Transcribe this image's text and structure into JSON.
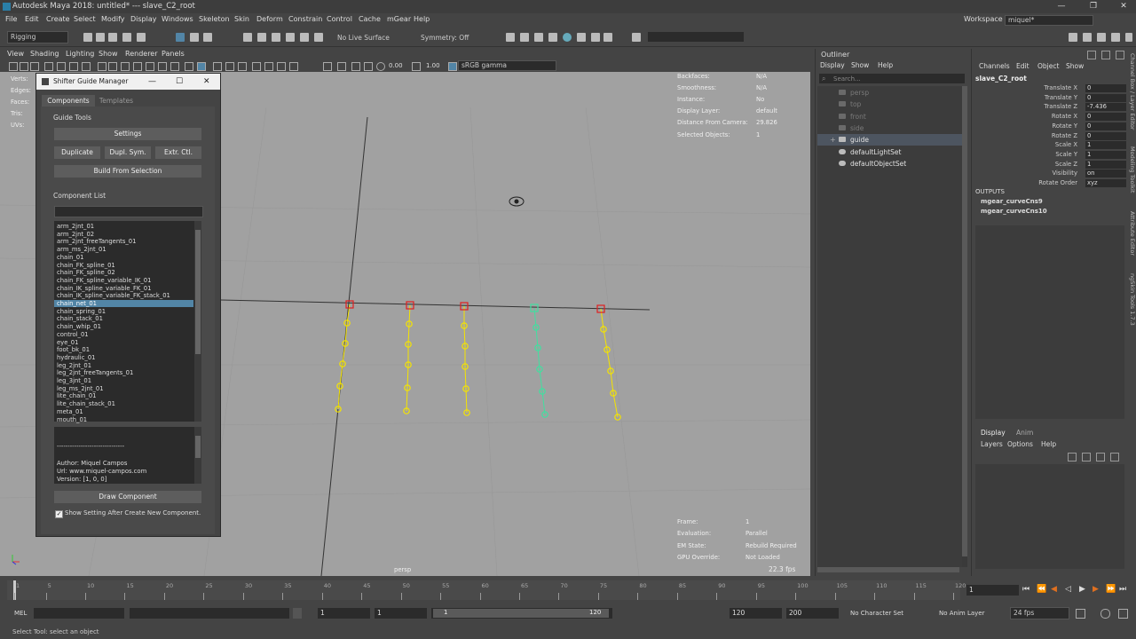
{
  "window": {
    "title": "Autodesk Maya 2018: untitled*   ---   slave_C2_root"
  },
  "menubar": [
    "File",
    "Edit",
    "Create",
    "Select",
    "Modify",
    "Display",
    "Windows",
    "Skeleton",
    "Skin",
    "Deform",
    "Constrain",
    "Control",
    "Cache",
    "mGear",
    "Help"
  ],
  "workspace": {
    "label": "Workspace :",
    "value": "miquel*"
  },
  "status": {
    "mode": "Rigging",
    "live_surface": "No Live Surface",
    "symmetry": "Symmetry: Off"
  },
  "viewport_menu": [
    "View",
    "Shading",
    "Lighting",
    "Show",
    "Renderer",
    "Panels"
  ],
  "viewport_toolbar": {
    "near": "0.00",
    "far": "1.00",
    "color_space": "sRGB gamma"
  },
  "hud_left": [
    "Verts:",
    "Edges:",
    "Faces:",
    "Tris:",
    "UVs:"
  ],
  "hud_top": [
    {
      "label": "Backfaces:",
      "value": "N/A"
    },
    {
      "label": "Smoothness:",
      "value": "N/A"
    },
    {
      "label": "Instance:",
      "value": "No"
    },
    {
      "label": "Display Layer:",
      "value": "default"
    },
    {
      "label": "Distance From Camera:",
      "value": "29.826"
    },
    {
      "label": "Selected Objects:",
      "value": "1"
    }
  ],
  "hud_bottom": [
    {
      "label": "Frame:",
      "value": "1"
    },
    {
      "label": "Evaluation:",
      "value": "Parallel"
    },
    {
      "label": "EM State:",
      "value": "Rebuild Required"
    },
    {
      "label": "GPU Override:",
      "value": "Not Loaded"
    }
  ],
  "fps": "22.3 fps",
  "camera": "persp",
  "shifter": {
    "title": "Shifter Guide Manager",
    "tabs": [
      "Components",
      "Templates"
    ],
    "guide_tools": "Guide Tools",
    "settings": "Settings",
    "duplicate": "Duplicate",
    "dupl_sym": "Dupl. Sym.",
    "extr_ctl": "Extr. Ctl.",
    "build_from_selection": "Build From Selection",
    "component_list": "Component List",
    "components": [
      "arm_2jnt_01",
      "arm_2jnt_02",
      "arm_2jnt_freeTangents_01",
      "arm_ms_2jnt_01",
      "chain_01",
      "chain_FK_spline_01",
      "chain_FK_spline_02",
      "chain_FK_spline_variable_IK_01",
      "chain_IK_spline_variable_FK_01",
      "chain_IK_spline_variable_FK_stack_01",
      "chain_net_01",
      "chain_spring_01",
      "chain_stack_01",
      "chain_whip_01",
      "control_01",
      "eye_01",
      "foot_bk_01",
      "hydraulic_01",
      "leg_2jnt_01",
      "leg_2jnt_freeTangents_01",
      "leg_3jnt_01",
      "leg_ms_2jnt_01",
      "lite_chain_01",
      "lite_chain_stack_01",
      "meta_01",
      "mouth_01"
    ],
    "selected_index": 10,
    "info_divider": "-------------------------------",
    "info_author": "Author: Miquel Campos",
    "info_url": "Url: www.miquel-campos.com",
    "info_version": "Version: [1, 0, 0]",
    "draw_component": "Draw Component",
    "show_setting": "Show Setting After Create New Component."
  },
  "outliner": {
    "title": "Outliner",
    "menu": [
      "Display",
      "Show",
      "Help"
    ],
    "search_placeholder": "Search...",
    "items": [
      {
        "name": "persp",
        "dim": true,
        "icon": "camera-icon"
      },
      {
        "name": "top",
        "dim": true,
        "icon": "camera-icon"
      },
      {
        "name": "front",
        "dim": true,
        "icon": "camera-icon"
      },
      {
        "name": "side",
        "dim": true,
        "icon": "camera-icon"
      },
      {
        "name": "guide",
        "dim": false,
        "icon": "transform-icon"
      },
      {
        "name": "defaultLightSet",
        "dim": false,
        "icon": "set-icon"
      },
      {
        "name": "defaultObjectSet",
        "dim": false,
        "icon": "set-icon"
      }
    ]
  },
  "channel_box": {
    "menu": [
      "Channels",
      "Edit",
      "Object",
      "Show"
    ],
    "object": "slave_C2_root",
    "attributes": [
      {
        "name": "Translate X",
        "value": "0"
      },
      {
        "name": "Translate Y",
        "value": "0"
      },
      {
        "name": "Translate Z",
        "value": "-7.436"
      },
      {
        "name": "Rotate X",
        "value": "0"
      },
      {
        "name": "Rotate Y",
        "value": "0"
      },
      {
        "name": "Rotate Z",
        "value": "0"
      },
      {
        "name": "Scale X",
        "value": "1"
      },
      {
        "name": "Scale Y",
        "value": "1"
      },
      {
        "name": "Scale Z",
        "value": "1"
      },
      {
        "name": "Visibility",
        "value": "on"
      },
      {
        "name": "Rotate Order",
        "value": "xyz"
      }
    ],
    "outputs_label": "OUTPUTS",
    "outputs": [
      "mgear_curveCns9",
      "mgear_curveCns10"
    ]
  },
  "layer_editor": {
    "tabs": [
      "Display",
      "Anim"
    ],
    "menu": [
      "Layers",
      "Options",
      "Help"
    ]
  },
  "side_tabs": [
    "Channel Box / Layer Editor",
    "Modeling Toolkit",
    "Attribute Editor",
    "ngSkin Tools 1.7.3"
  ],
  "timeline": {
    "ticks": [
      "1",
      "5",
      "10",
      "15",
      "20",
      "25",
      "30",
      "35",
      "40",
      "45",
      "50",
      "55",
      "60",
      "65",
      "70",
      "75",
      "80",
      "85",
      "90",
      "95",
      "100",
      "105",
      "110",
      "115",
      "120"
    ],
    "current": "1"
  },
  "range": {
    "start": "1",
    "start_inner": "1",
    "slider_start": "1",
    "slider_end": "120",
    "end_inner": "120",
    "end": "200",
    "char_set": "No Character Set",
    "anim_layer": "No Anim Layer",
    "fps": "24 fps"
  },
  "command": {
    "lang": "MEL",
    "help": "Select Tool: select an object"
  },
  "colors": {
    "viewport": "#a1a1a1",
    "selection": "#5285a6",
    "red_ctrl": "#e02020",
    "yellow_ctrl": "#f5e400",
    "green_ctrl": "#40e0a0"
  }
}
